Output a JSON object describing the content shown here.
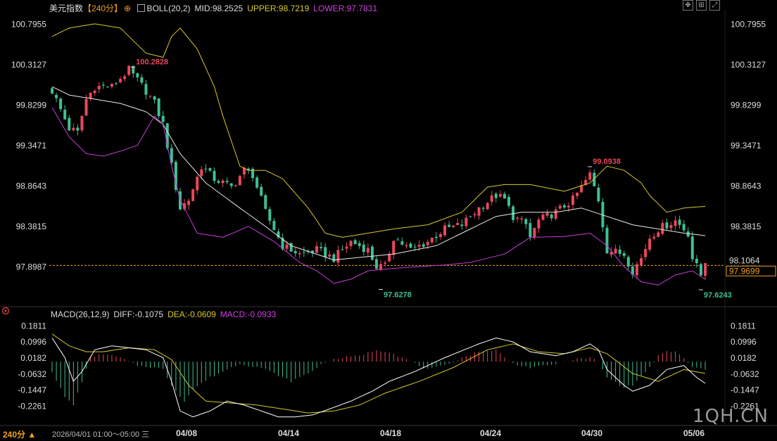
{
  "header": {
    "symbol": "美元指数",
    "period_tag": "【240分】",
    "indicator": "BOLL(20,2)",
    "mid": "MID:98.2525",
    "upper": "UPPER:98.7219",
    "lower": "LOWER:97.7831"
  },
  "macd_header": {
    "name": "MACD(26,12,9)",
    "diff": "DIFF:-0.1075",
    "dea": "DEA:-0.0609",
    "macd": "MACD:-0.0933"
  },
  "toolbar": {
    "icons": [
      "move-icon",
      "zoom-icon",
      "expand-icon"
    ]
  },
  "bottom": {
    "period": "240分 ▲",
    "range": "2026/04/01 01:00～05:00 三"
  },
  "watermark": "1QH.CN",
  "colors": {
    "up": "#e8485a",
    "down": "#3fbf95",
    "mid": "#e8e8e8",
    "upper": "#d8c82a",
    "lower": "#c83cd8",
    "diff": "#ffffff",
    "dea": "#d8c82a",
    "last_price": "#f0a020"
  },
  "chart_data": [
    {
      "type": "candlestick",
      "y_ticks": [
        "100.7955",
        "100.3127",
        "99.8299",
        "99.3471",
        "98.8643",
        "98.3815",
        "97.8987"
      ],
      "ylim": [
        97.59,
        100.9
      ],
      "x_ticks": [
        "04/08",
        "04/14",
        "04/18",
        "04/24",
        "04/30",
        "05/06"
      ],
      "annotations": [
        {
          "text": "100.2828",
          "value": 100.2828,
          "at": 19
        },
        {
          "text": "97.6278",
          "value": 97.6278,
          "at": 77
        },
        {
          "text": "99.0938",
          "value": 99.0938,
          "at": 126
        },
        {
          "text": "97.6243",
          "value": 97.6243,
          "at": 152
        }
      ],
      "last_price": {
        "text": "97.9699",
        "value": 97.9699
      },
      "ref_price": {
        "text": "98.1064",
        "value": 97.915
      },
      "close_knots": [
        [
          0,
          100.0
        ],
        [
          4,
          99.55
        ],
        [
          6,
          99.5
        ],
        [
          8,
          99.9
        ],
        [
          10,
          100.05
        ],
        [
          14,
          100.05
        ],
        [
          18,
          100.25
        ],
        [
          22,
          100.0
        ],
        [
          24,
          99.85
        ],
        [
          26,
          99.6
        ],
        [
          28,
          99.1
        ],
        [
          30,
          98.6
        ],
        [
          32,
          98.7
        ],
        [
          35,
          99.1
        ],
        [
          38,
          98.95
        ],
        [
          42,
          98.85
        ],
        [
          45,
          99.05
        ],
        [
          47,
          99.0
        ],
        [
          50,
          98.55
        ],
        [
          54,
          98.15
        ],
        [
          58,
          98.05
        ],
        [
          62,
          98.1
        ],
        [
          66,
          98.0
        ],
        [
          70,
          98.2
        ],
        [
          74,
          98.1
        ],
        [
          76,
          97.9
        ],
        [
          78,
          97.9
        ],
        [
          80,
          98.25
        ],
        [
          84,
          98.1
        ],
        [
          88,
          98.2
        ],
        [
          92,
          98.35
        ],
        [
          96,
          98.4
        ],
        [
          100,
          98.6
        ],
        [
          104,
          98.75
        ],
        [
          106,
          98.7
        ],
        [
          108,
          98.5
        ],
        [
          111,
          98.4
        ],
        [
          112,
          98.25
        ],
        [
          114,
          98.45
        ],
        [
          118,
          98.55
        ],
        [
          122,
          98.7
        ],
        [
          126,
          99.0
        ],
        [
          128,
          98.7
        ],
        [
          130,
          98.1
        ],
        [
          134,
          98.05
        ],
        [
          136,
          97.85
        ],
        [
          138,
          98.0
        ],
        [
          140,
          98.25
        ],
        [
          142,
          98.35
        ],
        [
          146,
          98.45
        ],
        [
          149,
          98.3
        ],
        [
          150,
          98.0
        ],
        [
          152,
          97.8
        ],
        [
          153,
          97.97
        ]
      ],
      "boll_mid_knots": [
        [
          0,
          100.05
        ],
        [
          4,
          99.95
        ],
        [
          10,
          99.9
        ],
        [
          16,
          99.85
        ],
        [
          22,
          99.75
        ],
        [
          26,
          99.6
        ],
        [
          30,
          99.25
        ],
        [
          36,
          98.9
        ],
        [
          44,
          98.6
        ],
        [
          50,
          98.38
        ],
        [
          56,
          98.15
        ],
        [
          66,
          97.98
        ],
        [
          74,
          98.02
        ],
        [
          80,
          98.05
        ],
        [
          90,
          98.15
        ],
        [
          98,
          98.35
        ],
        [
          104,
          98.5
        ],
        [
          110,
          98.55
        ],
        [
          118,
          98.55
        ],
        [
          124,
          98.6
        ],
        [
          130,
          98.5
        ],
        [
          136,
          98.4
        ],
        [
          142,
          98.35
        ],
        [
          148,
          98.3
        ],
        [
          153,
          98.27
        ]
      ],
      "boll_upper_knots": [
        [
          0,
          100.65
        ],
        [
          4,
          100.75
        ],
        [
          10,
          100.8
        ],
        [
          16,
          100.75
        ],
        [
          22,
          100.45
        ],
        [
          26,
          100.4
        ],
        [
          28,
          100.65
        ],
        [
          30,
          100.75
        ],
        [
          34,
          100.5
        ],
        [
          38,
          100.05
        ],
        [
          40,
          99.7
        ],
        [
          44,
          99.1
        ],
        [
          46,
          99.05
        ],
        [
          50,
          99.05
        ],
        [
          54,
          98.95
        ],
        [
          60,
          98.6
        ],
        [
          64,
          98.3
        ],
        [
          68,
          98.25
        ],
        [
          74,
          98.3
        ],
        [
          80,
          98.35
        ],
        [
          88,
          98.4
        ],
        [
          96,
          98.55
        ],
        [
          102,
          98.85
        ],
        [
          106,
          98.88
        ],
        [
          112,
          98.88
        ],
        [
          120,
          98.8
        ],
        [
          126,
          98.9
        ],
        [
          130,
          99.1
        ],
        [
          134,
          99.05
        ],
        [
          138,
          98.9
        ],
        [
          140,
          98.75
        ],
        [
          144,
          98.55
        ],
        [
          148,
          98.6
        ],
        [
          153,
          98.62
        ]
      ],
      "boll_lower_knots": [
        [
          0,
          99.8
        ],
        [
          4,
          99.45
        ],
        [
          8,
          99.25
        ],
        [
          12,
          99.22
        ],
        [
          16,
          99.28
        ],
        [
          20,
          99.35
        ],
        [
          24,
          99.7
        ],
        [
          26,
          99.6
        ],
        [
          28,
          99.1
        ],
        [
          30,
          98.7
        ],
        [
          34,
          98.3
        ],
        [
          40,
          98.25
        ],
        [
          46,
          98.38
        ],
        [
          52,
          98.2
        ],
        [
          58,
          97.95
        ],
        [
          62,
          97.85
        ],
        [
          66,
          97.7
        ],
        [
          70,
          97.75
        ],
        [
          74,
          97.85
        ],
        [
          80,
          97.88
        ],
        [
          86,
          97.9
        ],
        [
          92,
          97.92
        ],
        [
          98,
          97.95
        ],
        [
          106,
          98.05
        ],
        [
          112,
          98.25
        ],
        [
          120,
          98.26
        ],
        [
          126,
          98.3
        ],
        [
          130,
          98.15
        ],
        [
          134,
          97.9
        ],
        [
          138,
          97.72
        ],
        [
          142,
          97.68
        ],
        [
          146,
          97.8
        ],
        [
          150,
          97.85
        ],
        [
          153,
          97.75
        ]
      ],
      "bar_count": 154
    },
    {
      "type": "macd",
      "y_ticks": [
        "0.1811",
        "0.0996",
        "0.0182",
        "-0.0632",
        "-0.1447",
        "-0.2261"
      ],
      "ylim": [
        -0.306,
        0.2
      ],
      "diff_knots": [
        [
          0,
          0.12
        ],
        [
          3,
          0.02
        ],
        [
          5,
          -0.1
        ],
        [
          7,
          -0.05
        ],
        [
          10,
          0.06
        ],
        [
          14,
          0.08
        ],
        [
          18,
          0.07
        ],
        [
          22,
          0.06
        ],
        [
          26,
          0.02
        ],
        [
          28,
          -0.1
        ],
        [
          30,
          -0.25
        ],
        [
          33,
          -0.28
        ],
        [
          37,
          -0.25
        ],
        [
          41,
          -0.2
        ],
        [
          45,
          -0.22
        ],
        [
          49,
          -0.25
        ],
        [
          53,
          -0.28
        ],
        [
          57,
          -0.28
        ],
        [
          61,
          -0.27
        ],
        [
          65,
          -0.24
        ],
        [
          70,
          -0.2
        ],
        [
          75,
          -0.15
        ],
        [
          79,
          -0.1
        ],
        [
          85,
          -0.05
        ],
        [
          92,
          0.02
        ],
        [
          100,
          0.09
        ],
        [
          104,
          0.12
        ],
        [
          108,
          0.1
        ],
        [
          112,
          0.05
        ],
        [
          118,
          0.03
        ],
        [
          122,
          0.05
        ],
        [
          126,
          0.09
        ],
        [
          128,
          0.06
        ],
        [
          130,
          -0.04
        ],
        [
          134,
          -0.12
        ],
        [
          136,
          -0.15
        ],
        [
          140,
          -0.12
        ],
        [
          144,
          -0.04
        ],
        [
          148,
          -0.02
        ],
        [
          151,
          -0.08
        ],
        [
          153,
          -0.11
        ]
      ],
      "dea_knots": [
        [
          0,
          0.14
        ],
        [
          4,
          0.08
        ],
        [
          8,
          0.05
        ],
        [
          12,
          0.05
        ],
        [
          18,
          0.07
        ],
        [
          24,
          0.06
        ],
        [
          28,
          0.01
        ],
        [
          32,
          -0.12
        ],
        [
          36,
          -0.2
        ],
        [
          42,
          -0.21
        ],
        [
          48,
          -0.22
        ],
        [
          54,
          -0.24
        ],
        [
          60,
          -0.26
        ],
        [
          66,
          -0.25
        ],
        [
          72,
          -0.22
        ],
        [
          78,
          -0.16
        ],
        [
          86,
          -0.1
        ],
        [
          94,
          -0.03
        ],
        [
          102,
          0.06
        ],
        [
          108,
          0.09
        ],
        [
          114,
          0.05
        ],
        [
          120,
          0.04
        ],
        [
          126,
          0.07
        ],
        [
          130,
          0.04
        ],
        [
          136,
          -0.06
        ],
        [
          142,
          -0.1
        ],
        [
          148,
          -0.04
        ],
        [
          153,
          -0.06
        ]
      ],
      "hist_knots": [
        [
          0,
          -0.05
        ],
        [
          3,
          -0.18
        ],
        [
          5,
          -0.22
        ],
        [
          7,
          -0.1
        ],
        [
          9,
          0.02
        ],
        [
          12,
          0.04
        ],
        [
          16,
          0.02
        ],
        [
          18,
          0.0
        ],
        [
          20,
          -0.02
        ],
        [
          24,
          -0.03
        ],
        [
          26,
          -0.04
        ],
        [
          28,
          -0.12
        ],
        [
          31,
          -0.2
        ],
        [
          33,
          -0.14
        ],
        [
          37,
          -0.08
        ],
        [
          41,
          -0.04
        ],
        [
          44,
          -0.01
        ],
        [
          46,
          -0.02
        ],
        [
          49,
          -0.03
        ],
        [
          52,
          -0.06
        ],
        [
          56,
          -0.1
        ],
        [
          60,
          -0.06
        ],
        [
          64,
          0.0
        ],
        [
          68,
          0.02
        ],
        [
          72,
          0.03
        ],
        [
          76,
          0.06
        ],
        [
          79,
          0.05
        ],
        [
          82,
          0.02
        ],
        [
          84,
          0.0
        ],
        [
          88,
          -0.04
        ],
        [
          92,
          -0.02
        ],
        [
          96,
          0.02
        ],
        [
          100,
          0.05
        ],
        [
          104,
          0.06
        ],
        [
          106,
          0.02
        ],
        [
          108,
          -0.01
        ],
        [
          112,
          -0.03
        ],
        [
          116,
          -0.02
        ],
        [
          118,
          -0.01
        ],
        [
          122,
          0.01
        ],
        [
          126,
          0.02
        ],
        [
          128,
          0.0
        ],
        [
          130,
          -0.08
        ],
        [
          134,
          -0.13
        ],
        [
          136,
          -0.12
        ],
        [
          140,
          -0.03
        ],
        [
          142,
          0.03
        ],
        [
          144,
          0.05
        ],
        [
          146,
          0.05
        ],
        [
          148,
          0.02
        ],
        [
          150,
          -0.03
        ],
        [
          153,
          -0.04
        ]
      ]
    }
  ]
}
